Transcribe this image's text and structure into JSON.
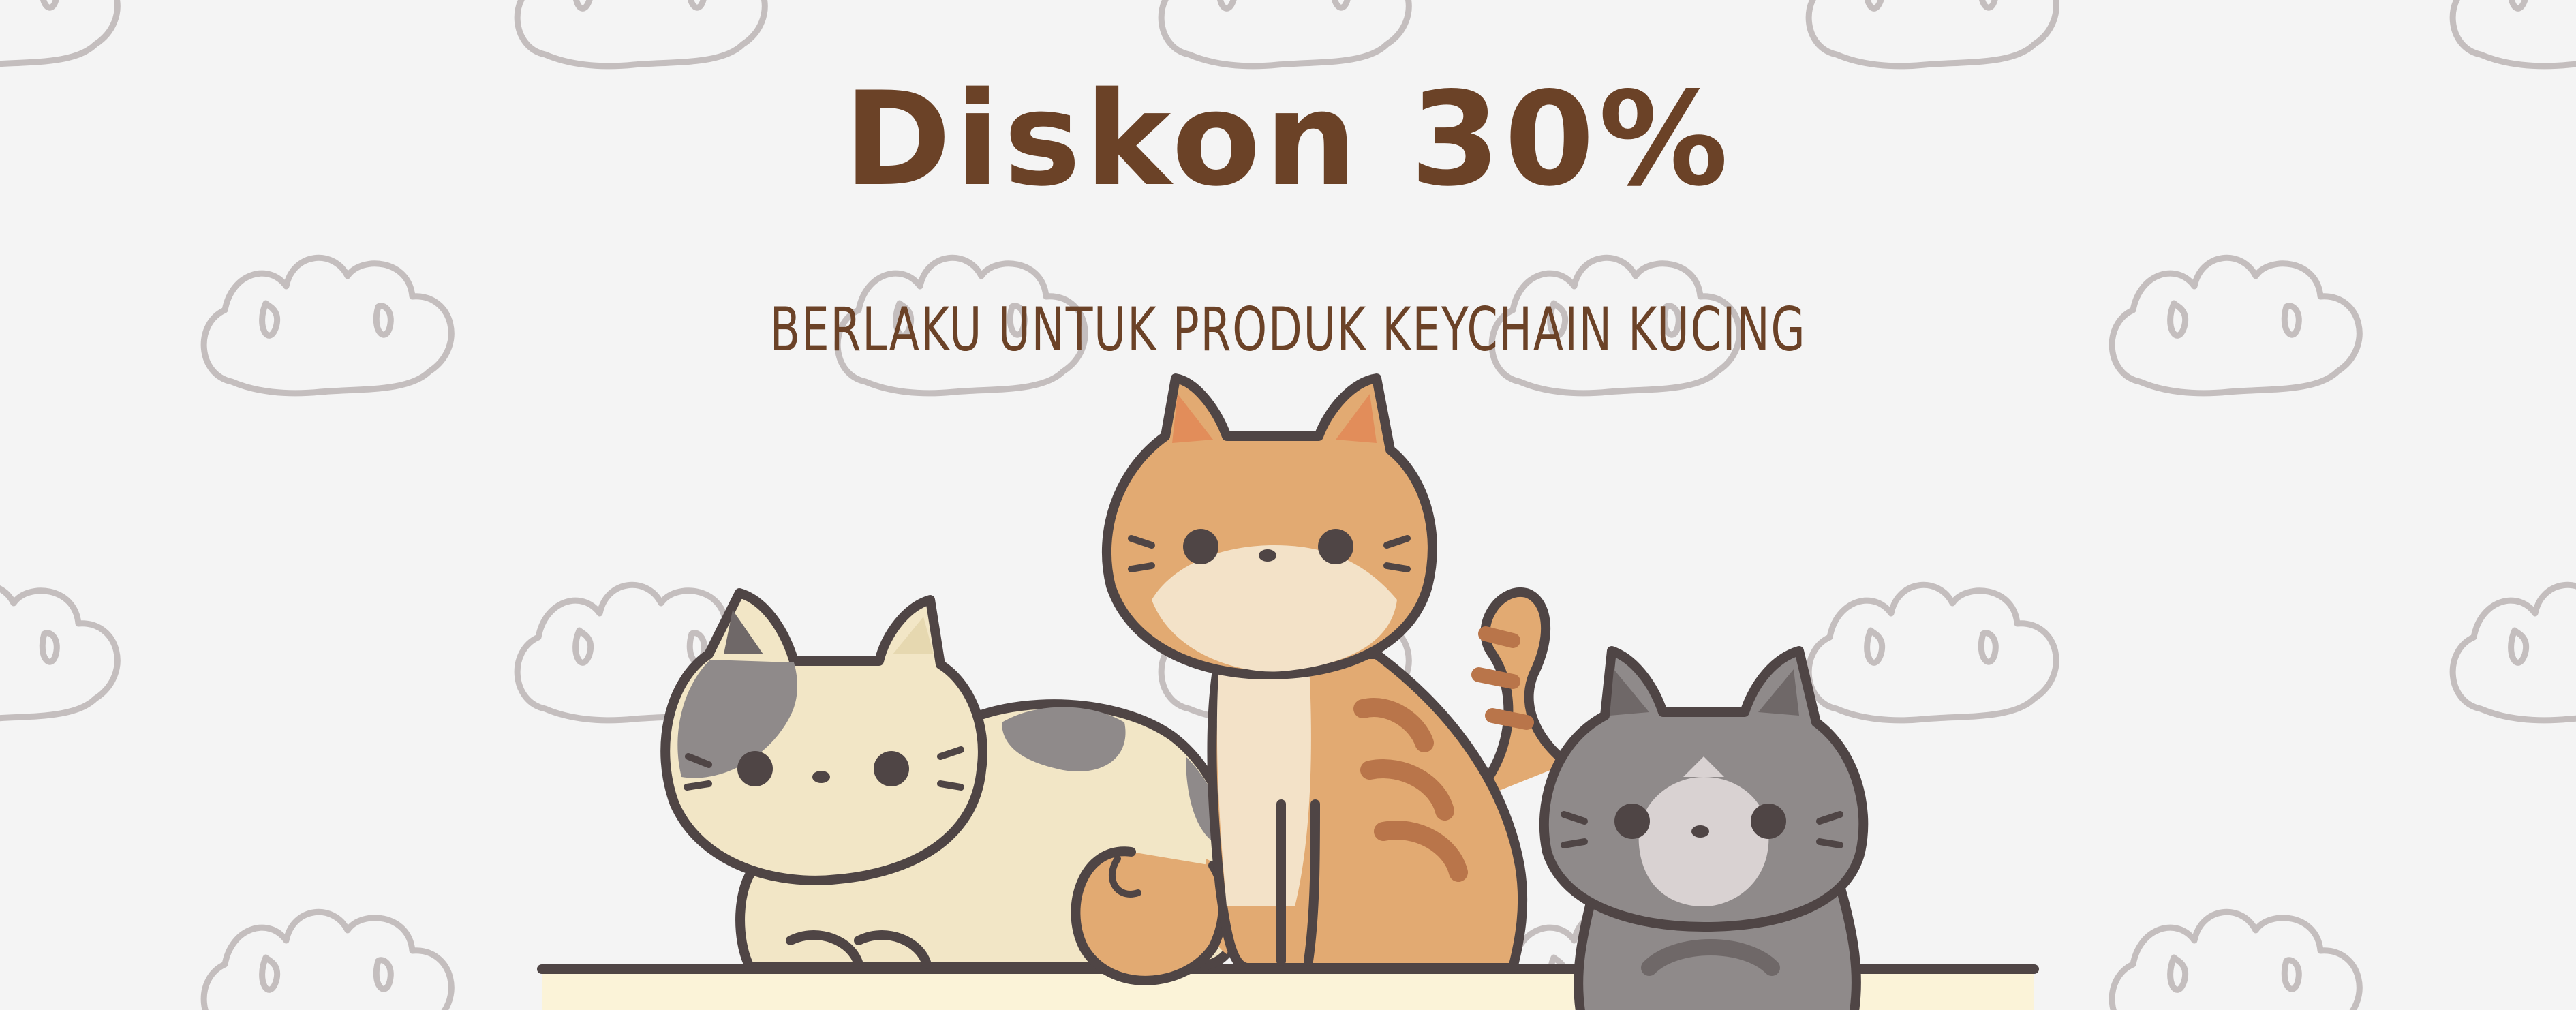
{
  "headline": "Diskon 30%",
  "subline": "BERLAKU UNTUK PRODUK KEYCHAIN KUCING",
  "colors": {
    "background": "#f4f4f4",
    "text": "#6b4227",
    "outline": "#4f4545",
    "pattern": "#c4bebe",
    "cream": "#f2e6c6",
    "orange": "#e2aa72",
    "gray": "#8f8a8a"
  },
  "illustration": [
    "calico-cat",
    "orange-tabby-cat",
    "gray-cat"
  ]
}
